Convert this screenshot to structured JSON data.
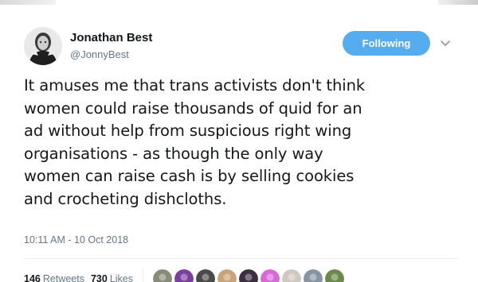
{
  "author": {
    "name": "Jonathan Best",
    "handle": "@JonnyBest"
  },
  "follow_button": {
    "label": "Following",
    "color": "#55acee"
  },
  "tweet": {
    "lines": [
      "It amuses me that trans activists don't think",
      "women could raise thousands of quid for an",
      "ad without help from suspicious right wing",
      "organisations - as though the only way",
      "women can raise cash is by selling cookies",
      "and crocheting dishcloths."
    ],
    "timestamp": "10:11 AM - 10 Oct 2018"
  },
  "stats": {
    "retweets_count": "146",
    "retweets_label": "Retweets",
    "likes_count": "730",
    "likes_label": "Likes"
  },
  "likers": [
    {
      "icon": "liker-avatar-1",
      "color": "#8a8a7a"
    },
    {
      "icon": "liker-avatar-2",
      "color": "#7b3f9e"
    },
    {
      "icon": "liker-avatar-3",
      "color": "#4a4a4a"
    },
    {
      "icon": "liker-avatar-4",
      "color": "#c9a37a"
    },
    {
      "icon": "liker-avatar-5",
      "color": "#3c2f3f"
    },
    {
      "icon": "liker-avatar-6",
      "color": "#d86ad8"
    },
    {
      "icon": "liker-avatar-7",
      "color": "#cfc8c0"
    },
    {
      "icon": "liker-avatar-8",
      "color": "#8795a3"
    },
    {
      "icon": "liker-avatar-9",
      "color": "#6b8a4a"
    }
  ],
  "colors": {
    "text": "#14171a",
    "secondary_text": "#657786",
    "divider": "#e6ecf0"
  }
}
